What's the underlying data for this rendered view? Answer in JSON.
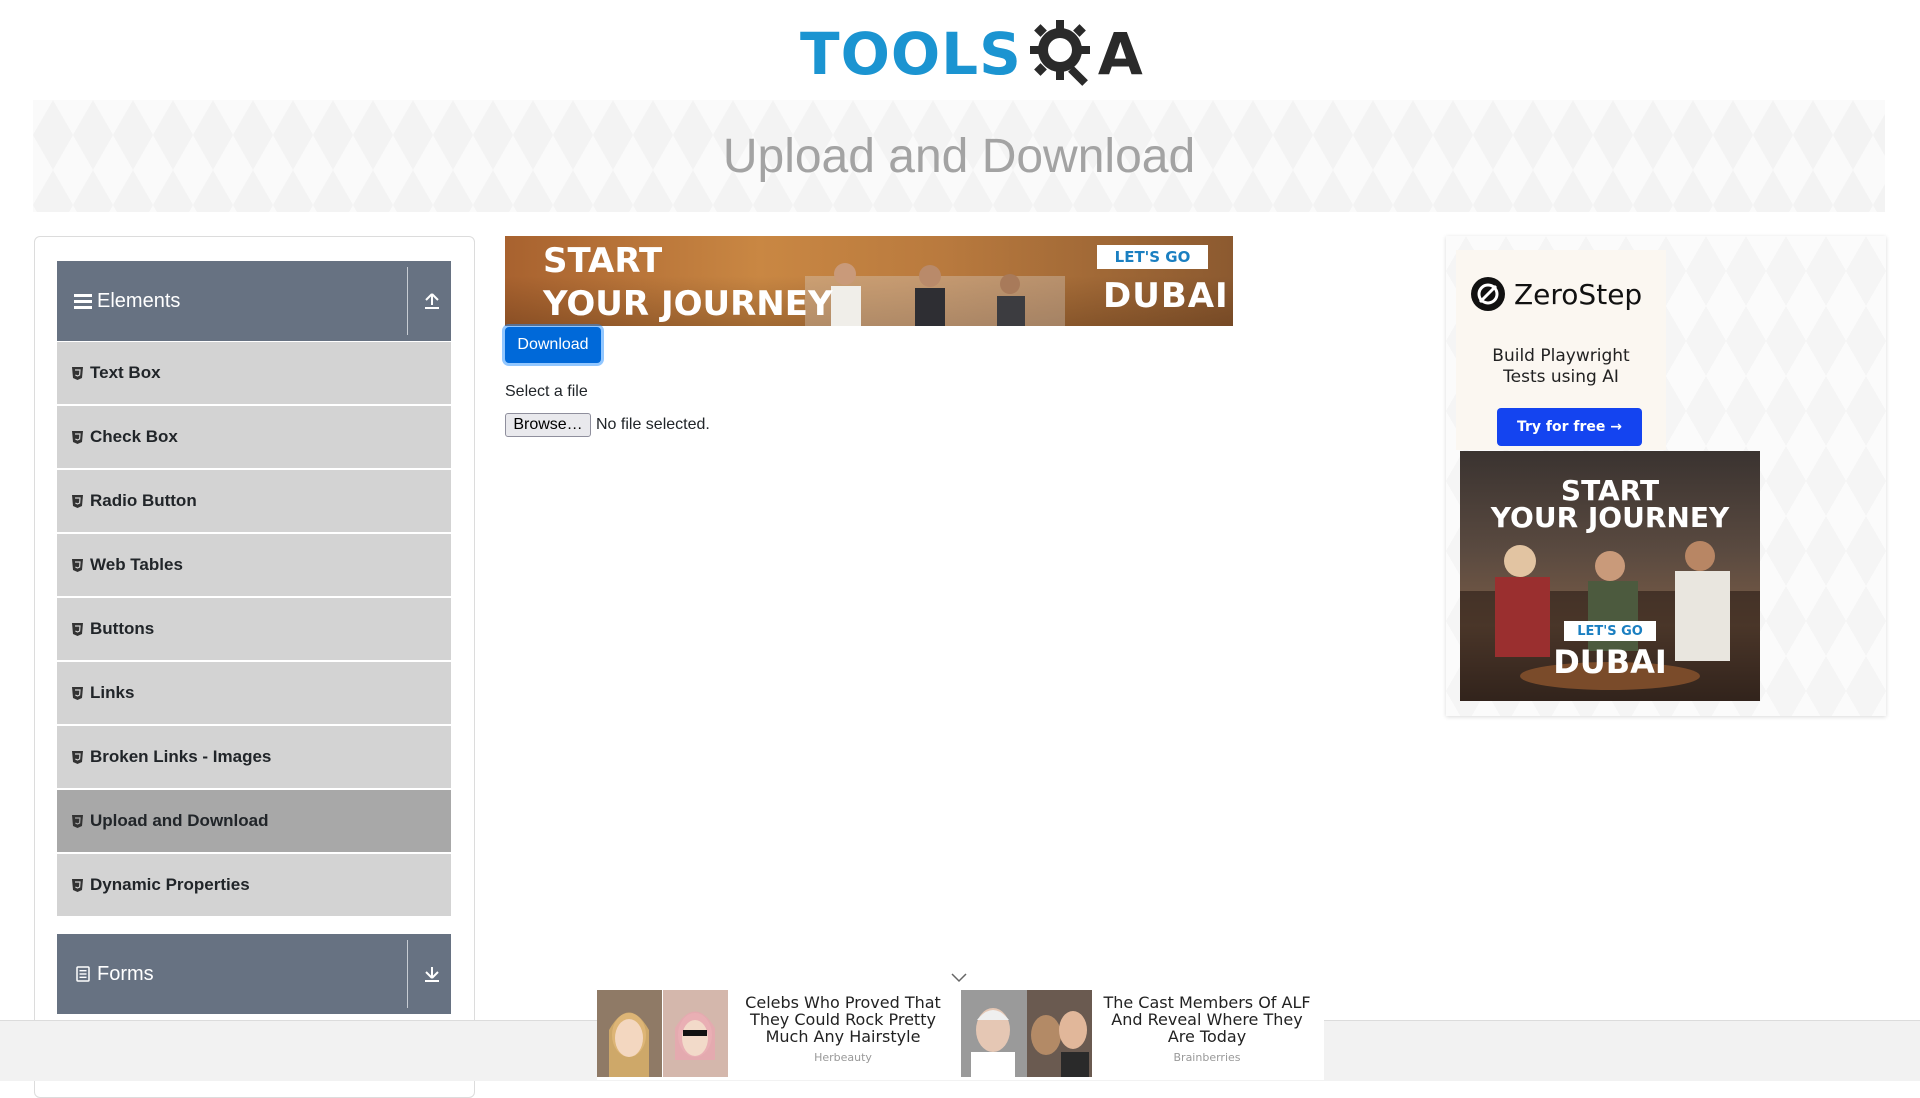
{
  "header": {
    "logo_text_tools": "TOOLS",
    "logo_text_a": "A",
    "page_title": "Upload and Download"
  },
  "sidebar": {
    "groups": [
      {
        "title": "Elements",
        "expanded": true,
        "items": [
          {
            "label": "Text Box"
          },
          {
            "label": "Check Box"
          },
          {
            "label": "Radio Button"
          },
          {
            "label": "Web Tables"
          },
          {
            "label": "Buttons"
          },
          {
            "label": "Links"
          },
          {
            "label": "Broken Links - Images"
          },
          {
            "label": "Upload and Download",
            "active": true
          },
          {
            "label": "Dynamic Properties"
          }
        ]
      },
      {
        "title": "Forms",
        "expanded": false
      }
    ]
  },
  "main": {
    "ad_banner": {
      "headline_line1": "START",
      "headline_line2": "YOUR JOURNEY",
      "cta": "LET'S GO",
      "brand": "DUBAI"
    },
    "download_button": "Download",
    "upload": {
      "label": "Select a file",
      "browse_button": "Browse…",
      "status": "No file selected."
    }
  },
  "right_ad": {
    "zerostep": {
      "name": "ZeroStep",
      "tagline_line1": "Build Playwright",
      "tagline_line2": "Tests using AI",
      "cta": "Try for free →"
    },
    "dubai": {
      "headline_line1": "START",
      "headline_line2": "YOUR JOURNEY",
      "cta": "LET'S GO",
      "brand": "DUBAI"
    }
  },
  "bottom_ads": [
    {
      "title_line1": "Celebs Who Proved That",
      "title_line2": "They Could Rock Pretty",
      "title_line3": "Much Any Hairstyle",
      "source": "Herbeauty"
    },
    {
      "title_line1": "The Cast Members Of ALF",
      "title_line2": "And Reveal Where They",
      "title_line3": "Are Today",
      "source": "Brainberries"
    }
  ],
  "colors": {
    "logo_blue": "#1b94d1",
    "sidebar_header": "#677282",
    "menu_item": "#d3d3d3",
    "menu_item_active": "#a8a8a8",
    "primary_button": "#0069d9",
    "zerostep_button": "#1444f0"
  },
  "icons": {
    "elements_group": "list-icon",
    "collapse": "upload-arrow-icon",
    "expand": "download-arrow-icon",
    "menu_item": "html5-badge-icon",
    "forms_group": "document-icon"
  }
}
